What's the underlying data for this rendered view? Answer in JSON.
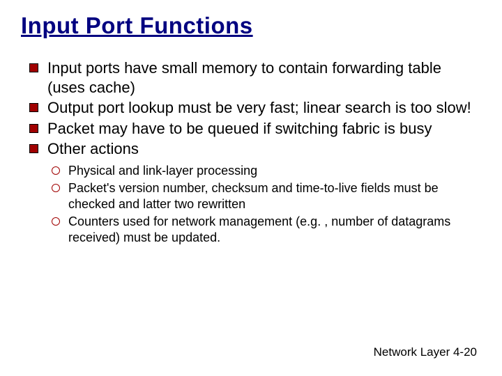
{
  "title": "Input Port Functions",
  "bullets": [
    "Input ports have small memory to contain forwarding table (uses cache)",
    "Output port lookup must be very fast; linear search is too slow!",
    "Packet may have to be queued if switching fabric is busy",
    "Other actions"
  ],
  "subbullets": [
    "Physical and link-layer processing",
    "Packet's version number, checksum and time-to-live fields must be checked and latter two rewritten",
    "Counters used for network management (e.g. , number of datagrams received) must be updated."
  ],
  "footer": "Network Layer   4-20"
}
